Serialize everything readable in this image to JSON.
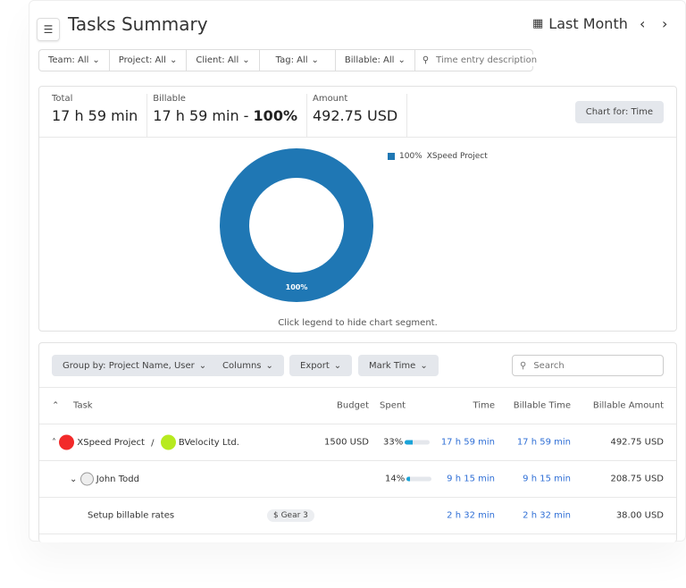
{
  "header": {
    "title": "Tasks Summary",
    "period": "Last Month",
    "icons": {
      "menu": "menu-icon",
      "calendar": "calendar-icon",
      "prev": "chevron-left-icon",
      "next": "chevron-right-icon"
    }
  },
  "filters": {
    "items": [
      "Team: All",
      "Project: All",
      "Client: All",
      "Tag: All",
      "Billable: All"
    ],
    "search_placeholder": "Time entry description"
  },
  "summary": {
    "total_label": "Total",
    "total_value": "17 h 59 min",
    "billable_label": "Billable",
    "billable_value": "17 h 59 min",
    "billable_sep": " - ",
    "billable_pct": "100%",
    "amount_label": "Amount",
    "amount_value": "492.75 USD",
    "chart_button": "Chart for: Time",
    "hint": "Click legend to hide chart segment."
  },
  "chart_data": {
    "type": "pie",
    "donut": true,
    "categories": [
      "XSpeed Project"
    ],
    "values": [
      100
    ],
    "labels": [
      "100%"
    ],
    "legend": [
      {
        "pct": "100%",
        "name": "XSpeed Project"
      }
    ],
    "legend_placement": "top-right",
    "colors": [
      "#1f77b4"
    ]
  },
  "table": {
    "toolbar": [
      "Group by: Project Name, User",
      "Columns",
      "Export",
      "Mark Time"
    ],
    "search_placeholder": "Search",
    "columns": [
      "Task",
      "Budget",
      "Spent",
      "Time",
      "Billable Time",
      "Billable Amount"
    ],
    "project_row": {
      "project": "XSpeed Project",
      "sep": "/",
      "client": "BVelocity Ltd.",
      "project_color": "#f22a2a",
      "client_color": "#b7ea1f",
      "budget": "1500 USD",
      "spent": "33%",
      "spent_fraction": 0.33,
      "time": "17 h 59 min",
      "billable_time": "17 h 59 min",
      "billable_amount": "492.75 USD"
    },
    "user_row": {
      "name": "John Todd",
      "spent": "14%",
      "spent_fraction": 0.14,
      "time": "9 h 15 min",
      "billable_time": "9 h 15 min",
      "billable_amount": "208.75 USD"
    },
    "task_row": {
      "name": "Setup billable rates",
      "tag": "$ Gear 3",
      "time": "2 h 32 min",
      "billable_time": "2 h 32 min",
      "billable_amount": "38.00 USD"
    }
  }
}
